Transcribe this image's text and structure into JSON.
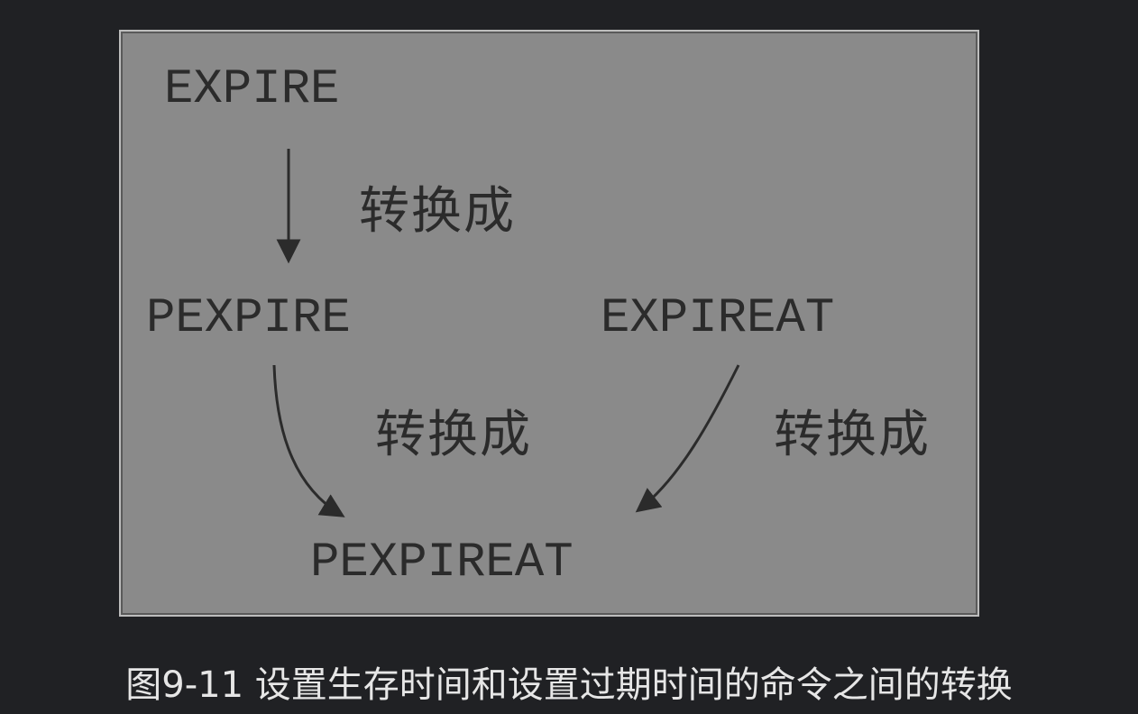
{
  "diagram": {
    "nodes": {
      "expire": "EXPIRE",
      "pexpire": "PEXPIRE",
      "expireat": "EXPIREAT",
      "pexpireat": "PEXPIREAT"
    },
    "edge_labels": {
      "expire_to_pexpire": "转换成",
      "pexpire_to_pexpireat": "转换成",
      "expireat_to_pexpireat": "转换成"
    }
  },
  "caption": "图9-11 设置生存时间和设置过期时间的命令之间的转换"
}
